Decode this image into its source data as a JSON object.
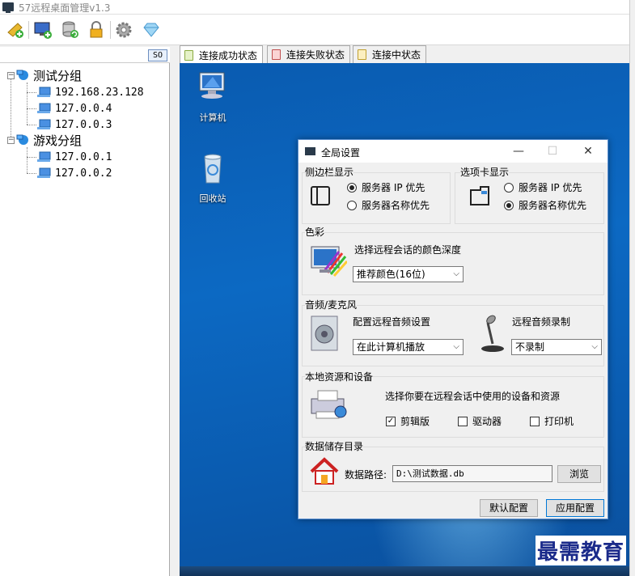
{
  "window": {
    "title": "57远程桌面管理v1.3"
  },
  "toolbar": {
    "buttons": [
      {
        "name": "add-group",
        "icon": "broom-add-icon"
      },
      {
        "name": "add-host",
        "icon": "monitor-add-icon"
      },
      {
        "name": "refresh",
        "icon": "database-refresh-icon"
      },
      {
        "name": "lock",
        "icon": "lock-icon"
      },
      {
        "name": "settings",
        "icon": "gear-icon"
      },
      {
        "name": "about",
        "icon": "diamond-icon"
      }
    ]
  },
  "sidebar": {
    "so_button": "SO",
    "groups": [
      {
        "label": "测试分组",
        "hosts": [
          "192.168.23.128",
          "127.0.0.4",
          "127.0.0.3"
        ]
      },
      {
        "label": "游戏分组",
        "hosts": [
          "127.0.0.1",
          "127.0.0.2"
        ]
      }
    ]
  },
  "tabs": [
    {
      "label": "连接成功状态",
      "active": true,
      "color": "#b5d96a"
    },
    {
      "label": "连接失败状态",
      "active": false,
      "color": "#f08080"
    },
    {
      "label": "连接中状态",
      "active": false,
      "color": "#f5d36b"
    }
  ],
  "desktop": {
    "icons": [
      {
        "label": "计算机"
      },
      {
        "label": "回收站"
      }
    ]
  },
  "dialog": {
    "title": "全局设置",
    "sidebar_display": {
      "label": "侧边栏显示",
      "options": [
        "服务器 IP 优先",
        "服务器名称优先"
      ],
      "selected": 0
    },
    "tab_display": {
      "label": "选项卡显示",
      "options": [
        "服务器 IP 优先",
        "服务器名称优先"
      ],
      "selected": 1
    },
    "color": {
      "label": "色彩",
      "prompt": "选择远程会话的颜色深度",
      "value": "推荐颜色(16位)"
    },
    "audio": {
      "label": "音频/麦克风",
      "playback_label": "配置远程音频设置",
      "playback_value": "在此计算机播放",
      "record_label": "远程音频录制",
      "record_value": "不录制"
    },
    "local_resources": {
      "label": "本地资源和设备",
      "prompt": "选择你要在远程会话中使用的设备和资源",
      "items": [
        {
          "label": "剪辑版",
          "checked": true
        },
        {
          "label": "驱动器",
          "checked": false
        },
        {
          "label": "打印机",
          "checked": false
        }
      ]
    },
    "storage": {
      "label": "数据储存目录",
      "path_label": "数据路径:",
      "path_value": "D:\\测试数据.db",
      "browse": "浏览"
    },
    "buttons": {
      "default": "默认配置",
      "apply": "应用配置"
    }
  },
  "watermark": "最需教育"
}
